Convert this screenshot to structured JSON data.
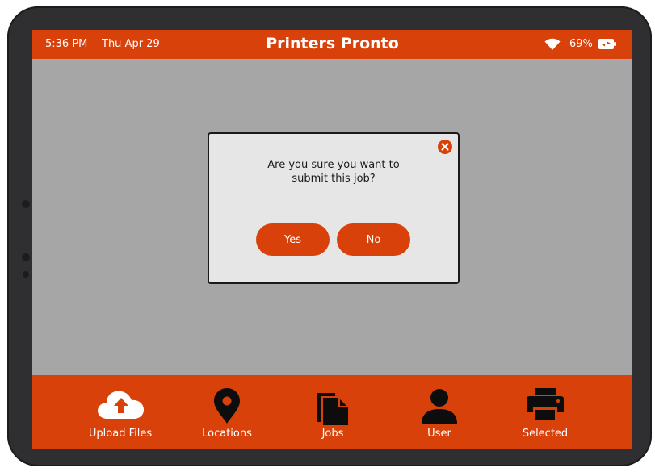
{
  "status_bar": {
    "time": "5:36 PM",
    "date": "Thu Apr 29",
    "battery_percent": "69%",
    "icons": [
      "wifi-icon",
      "battery-charging-icon"
    ]
  },
  "app": {
    "title": "Printers Pronto",
    "accent_color": "#d9410b"
  },
  "dialog": {
    "message": "Are you sure you want to\nsubmit this job?",
    "yes_label": "Yes",
    "no_label": "No",
    "close_icon": "close-icon"
  },
  "tab_bar": {
    "items": [
      {
        "label": "Upload Files",
        "icon": "cloud-upload-icon"
      },
      {
        "label": "Locations",
        "icon": "location-pin-icon"
      },
      {
        "label": "Jobs",
        "icon": "documents-icon"
      },
      {
        "label": "User",
        "icon": "user-icon"
      },
      {
        "label": "Selected",
        "icon": "printer-icon"
      }
    ]
  }
}
